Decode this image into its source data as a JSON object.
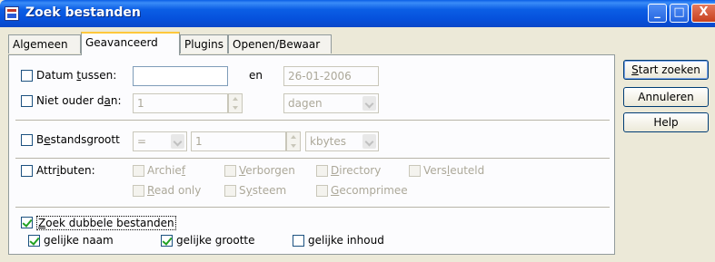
{
  "window": {
    "title": "Zoek bestanden"
  },
  "title_buttons": {
    "minimize": "_",
    "maximize": "□",
    "close": "X"
  },
  "tabs": [
    {
      "label": "Algemeen",
      "active": false
    },
    {
      "label": "Geavanceerd",
      "active": true
    },
    {
      "label": "Plugins",
      "active": false
    },
    {
      "label": "Openen/Bewaar",
      "active": false
    }
  ],
  "date": {
    "label_pre": "Datum ",
    "label_key": "t",
    "label_post": "ussen:",
    "and_label": "en",
    "from_value": "",
    "to_value": "26-01-2006",
    "checked": false
  },
  "not_older": {
    "label_pre": "Niet ouder d",
    "label_key": "a",
    "label_post": "n:",
    "value": "1",
    "unit": "dagen",
    "checked": false
  },
  "filesize": {
    "label_pre": "B",
    "label_key": "e",
    "label_post": "standsgroott",
    "operator": "=",
    "value": "1",
    "unit": "kbytes",
    "checked": false
  },
  "attributes": {
    "label_pre": "Attr",
    "label_key": "i",
    "label_post": "buten:",
    "checked": false,
    "archive": {
      "pre": "Archie",
      "key": "f",
      "post": ""
    },
    "hidden": {
      "pre": "",
      "key": "V",
      "post": "erborgen"
    },
    "directory": {
      "pre": "",
      "key": "D",
      "post": "irectory"
    },
    "encrypted": {
      "pre": "Vers",
      "key": "l",
      "post": "euteld"
    },
    "readonly": {
      "pre": "",
      "key": "R",
      "post": "ead only"
    },
    "system": {
      "pre": "S",
      "key": "y",
      "post": "steem"
    },
    "compressed": {
      "pre": "",
      "key": "G",
      "post": "ecomprimee"
    }
  },
  "duplicates": {
    "label_pre": "",
    "label_key": "Z",
    "label_post": "oek dubbele bestanden",
    "checked": true,
    "same_name": {
      "label": "gelijke naam",
      "checked": true
    },
    "same_size": {
      "label": "gelijke grootte",
      "checked": true
    },
    "same_content": {
      "label": "gelijke inhoud",
      "checked": false
    }
  },
  "buttons": {
    "start_pre": "",
    "start_key": "S",
    "start_post": "tart zoeken",
    "cancel": "Annuleren",
    "help": "Help"
  }
}
